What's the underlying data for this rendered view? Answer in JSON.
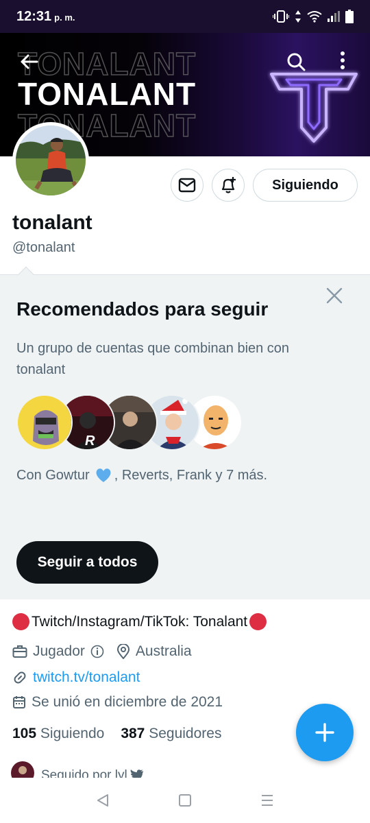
{
  "status_bar": {
    "time": "12:31",
    "ampm": "p. m."
  },
  "banner": {
    "wordmark": "TONALANT"
  },
  "profile": {
    "display_name": "tonalant",
    "handle": "@tonalant",
    "follow_state": "Siguiendo"
  },
  "recommendations": {
    "title": "Recomendados para seguir",
    "description": "Un grupo de cuentas que combinan bien con tonalant",
    "with_prefix": "Con Gowtur",
    "with_suffix": ", Reverts, Frank y 7 más.",
    "follow_all": "Seguir a todos"
  },
  "bio": {
    "text": "Twitch/Instagram/TikTok: Tonalant"
  },
  "meta": {
    "category": "Jugador",
    "location": "Australia",
    "website": "twitch.tv/tonalant",
    "joined": "Se unió en diciembre de 2021"
  },
  "stats": {
    "following_count": "105",
    "following_label": "Siguiendo",
    "followers_count": "387",
    "followers_label": "Seguidores"
  },
  "followed_by": "Seguido por lyl",
  "colors": {
    "accent": "#1d9bf0",
    "heart": "#5dadec",
    "red_dot": "#dd2e44",
    "neon": "#b08cff"
  }
}
